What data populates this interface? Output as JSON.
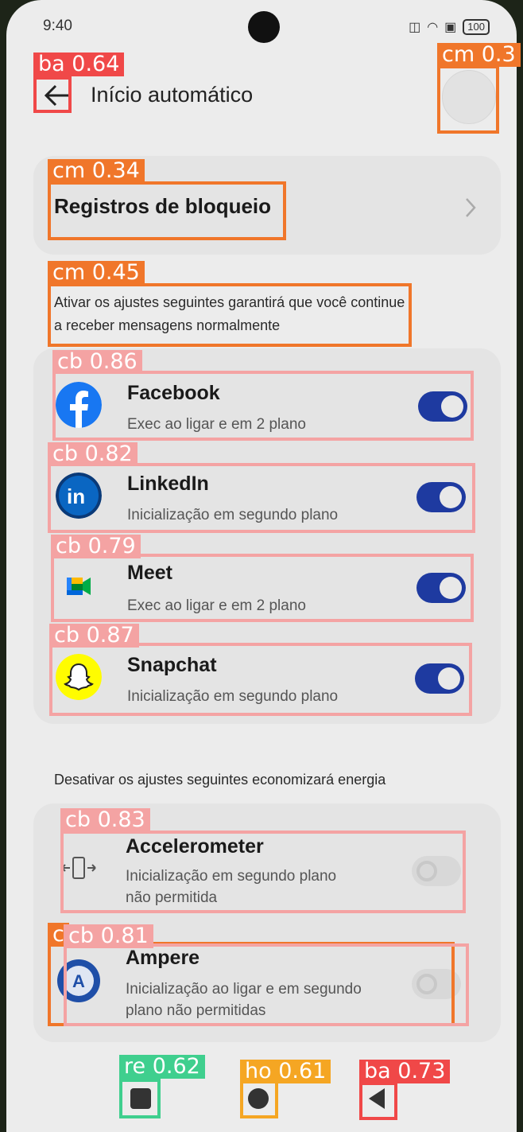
{
  "status": {
    "time": "9:40",
    "battery": "100"
  },
  "header": {
    "title": "Início automático"
  },
  "block_logs": {
    "label": "Registros de bloqueio"
  },
  "allow_section": {
    "description": "Ativar os ajustes seguintes garantirá que você continue a receber mensagens normalmente"
  },
  "allowed_apps": [
    {
      "name": "Facebook",
      "subtitle": "Exec ao ligar e em 2 plano",
      "enabled": true
    },
    {
      "name": "LinkedIn",
      "subtitle": "Inicialização em segundo plano",
      "enabled": true
    },
    {
      "name": "Meet",
      "subtitle": "Exec ao ligar e em 2 plano",
      "enabled": true
    },
    {
      "name": "Snapchat",
      "subtitle": "Inicialização em segundo plano",
      "enabled": true
    }
  ],
  "disable_section": {
    "heading": "Desativar os ajustes seguintes economizará energia"
  },
  "disabled_apps": [
    {
      "name": "Accelerometer",
      "subtitle_line1": "Inicialização em segundo plano",
      "subtitle_line2": "não permitida",
      "enabled": false
    },
    {
      "name": "Ampere",
      "subtitle_line1": "Inicialização ao ligar e em segundo",
      "subtitle_line2": "plano não permitidas",
      "enabled": false
    }
  ],
  "detections": [
    {
      "label": "ba 0.64"
    },
    {
      "label": "cm 0.3"
    },
    {
      "label": "cm 0.34"
    },
    {
      "label": "cm 0.45"
    },
    {
      "label": "cb 0.86"
    },
    {
      "label": "cb 0.82"
    },
    {
      "label": "cb 0.79"
    },
    {
      "label": "cb 0.87"
    },
    {
      "label": "cb 0.83"
    },
    {
      "label": "cb 0.81"
    },
    {
      "label": "c"
    },
    {
      "label": "re 0.62"
    },
    {
      "label": "ho 0.61"
    },
    {
      "label": "ba 0.73"
    }
  ],
  "colors": {
    "toggle_on": "#1e3aa0",
    "facebook": "#1877f2",
    "linkedin": "#0a66c2",
    "box_red": "#f04848",
    "box_orange": "#f0762a",
    "box_pink": "#f4a3a3",
    "box_green": "#3fcf8e",
    "box_yellow": "#f5a623"
  }
}
